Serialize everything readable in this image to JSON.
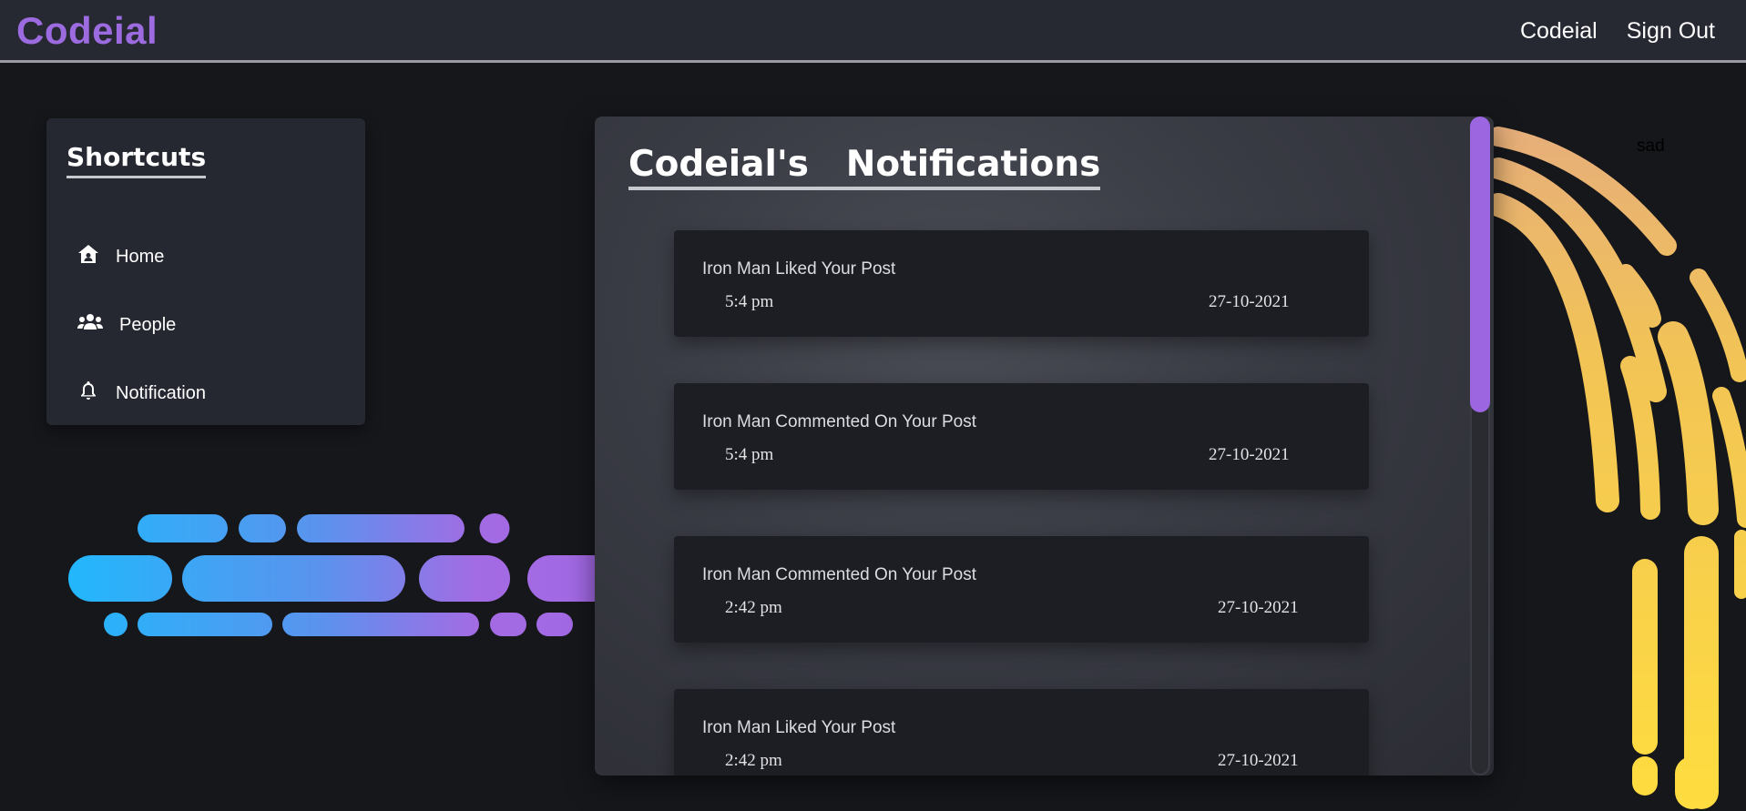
{
  "header": {
    "brand": "Codeial",
    "links": [
      "Codeial",
      "Sign Out"
    ]
  },
  "shortcuts": {
    "title": "Shortcuts",
    "items": [
      {
        "label": "Home",
        "icon": "home-icon"
      },
      {
        "label": "People",
        "icon": "people-icon"
      },
      {
        "label": "Notification",
        "icon": "bell-icon"
      }
    ]
  },
  "notifications": {
    "title": "Codeial's   Notifications",
    "items": [
      {
        "text": "Iron Man Liked Your Post",
        "time": "5:4 pm",
        "date": "27-10-2021"
      },
      {
        "text": "Iron Man Commented On Your Post",
        "time": "5:4 pm",
        "date": "27-10-2021"
      },
      {
        "text": "Iron Man Commented On Your Post",
        "time": "2:42 pm",
        "date": "27-10-2021"
      },
      {
        "text": "Iron Man Liked Your Post",
        "time": "2:42 pm",
        "date": "27-10-2021"
      }
    ]
  },
  "stray_text": "sad",
  "colors": {
    "brand": "#9c6be0",
    "background": "#16171b",
    "navbar": "#262832",
    "scroll_thumb": "#9b66e0",
    "deco_blue": "#19bdfd",
    "deco_purple": "#a167e4",
    "deco_yellow": "#ffdd3f",
    "deco_peach": "#e6b07e"
  }
}
